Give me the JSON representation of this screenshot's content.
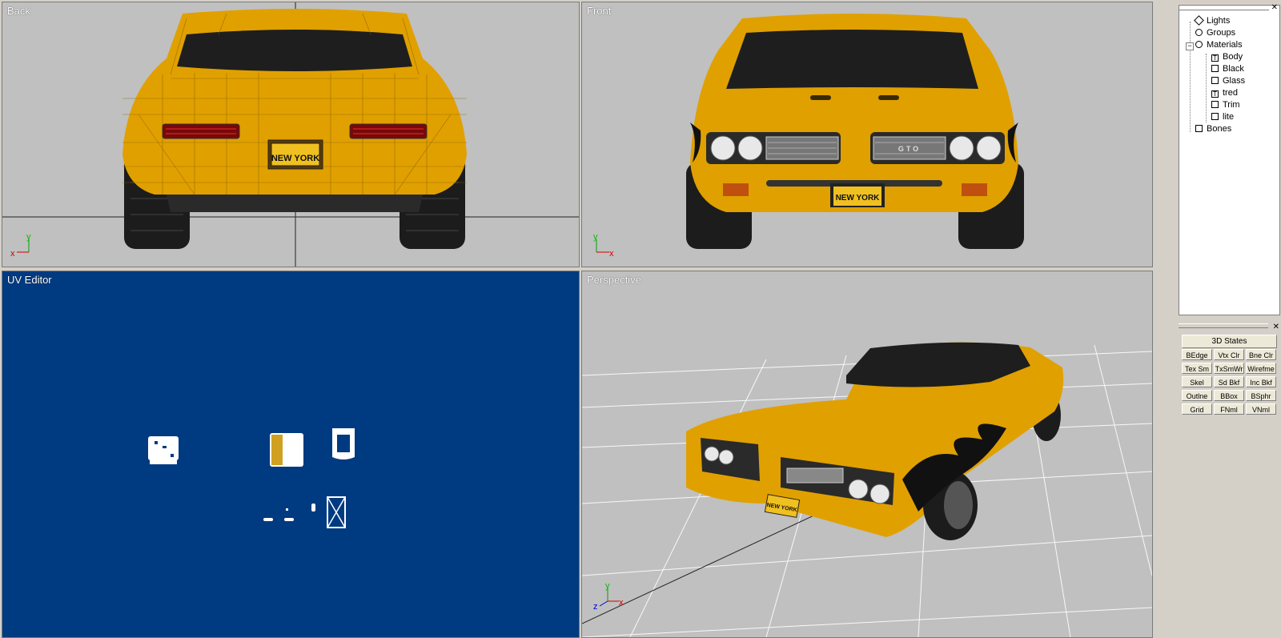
{
  "viewports": {
    "back": {
      "label": "Back"
    },
    "front": {
      "label": "Front"
    },
    "uv": {
      "label": "UV Editor"
    },
    "perspective": {
      "label": "Perspective"
    }
  },
  "axes": {
    "x": "x",
    "y": "y",
    "z": "z"
  },
  "license_plate": {
    "state": "NEW YORK",
    "text": "NEW YORK"
  },
  "grille_badge": "GTO",
  "tree": {
    "lights": "Lights",
    "groups": "Groups",
    "materials": "Materials",
    "material_items": [
      "Body",
      "Black",
      "Glass",
      "tred",
      "Trim",
      "lite"
    ],
    "bones": "Bones"
  },
  "states": {
    "title": "3D States",
    "buttons": [
      "BEdge",
      "Vtx Clr",
      "Bne Clr",
      "Tex Sm",
      "TxSmWr",
      "Wirefme",
      "Skel",
      "Sd Bkf",
      "Inc Bkf",
      "Outlne",
      "BBox",
      "BSphr",
      "Grid",
      "FNml",
      "VNml"
    ]
  },
  "colors": {
    "body": "#e0a000",
    "uv_bg": "#003a80",
    "viewport_bg": "#c0c0c0"
  }
}
